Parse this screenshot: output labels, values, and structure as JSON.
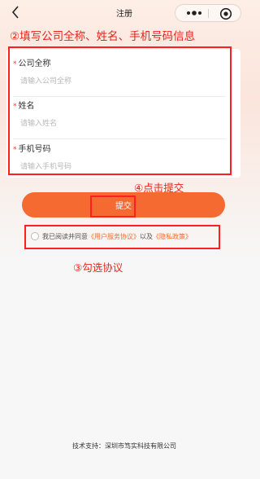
{
  "navbar": {
    "title": "注册",
    "back_icon": "chevron-left-icon",
    "more_icon": "more-dots-icon",
    "close_icon": "target-close-icon"
  },
  "annotations": {
    "step2": "②填写公司全称、姓名、手机号码信息",
    "step4": "④点击提交",
    "step3": "③勾选协议"
  },
  "form": {
    "required_mark": "*",
    "fields": [
      {
        "label": "公司全称",
        "placeholder": "请输入公司全称",
        "value": ""
      },
      {
        "label": "姓名",
        "placeholder": "请输入姓名",
        "value": ""
      },
      {
        "label": "手机号码",
        "placeholder": "请输入手机号码",
        "value": ""
      }
    ]
  },
  "submit": {
    "label": "提交"
  },
  "agreement": {
    "checked": false,
    "prefix": "我已阅读并同意",
    "user_agreement": "《用户服务协议》",
    "connector": "以及",
    "privacy_policy": "《隐私政策》"
  },
  "footer": {
    "text": "技术支持：深圳市笃实科技有限公司"
  },
  "colors": {
    "accent": "#f56a31",
    "annotation": "#e8251c",
    "required": "#f03a2a"
  }
}
